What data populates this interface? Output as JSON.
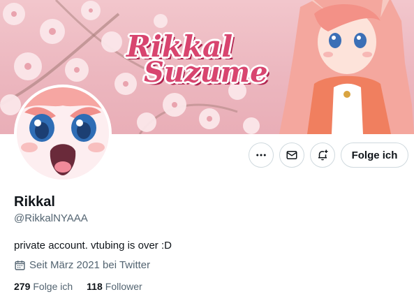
{
  "banner": {
    "title_line1": "Rikkal",
    "title_line2": "Suzume"
  },
  "actions": {
    "more_icon": "more-dots-icon",
    "message_icon": "envelope-icon",
    "notify_icon": "bell-plus-icon",
    "follow_label": "Folge ich"
  },
  "profile": {
    "display_name": "Rikkal",
    "handle": "@RikkalNYAAA",
    "bio": "private account. vtubing is over :D",
    "joined_icon": "calendar-icon",
    "joined": "Seit März 2021 bei Twitter",
    "following_count": "279",
    "following_label": "Folge ich",
    "followers_count": "118",
    "followers_label": "Follower"
  },
  "colors": {
    "banner_pink": "#ecb7bf",
    "title_pink": "#d8456f",
    "text": "#0f1419",
    "muted": "#536471",
    "border": "#cfd9de"
  }
}
